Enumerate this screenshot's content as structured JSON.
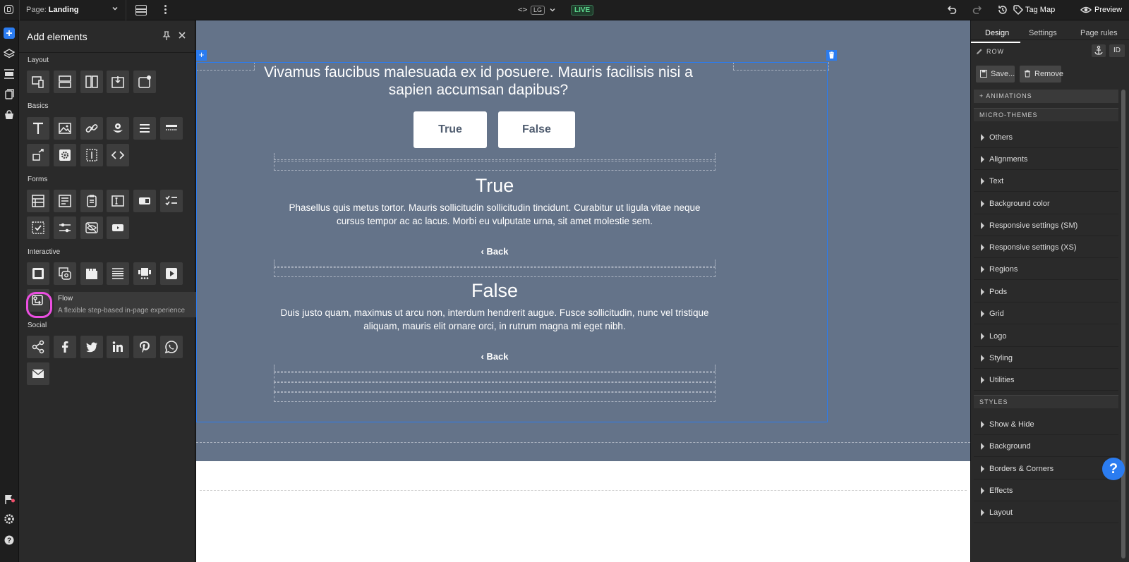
{
  "topbar": {
    "page_label": "Page:",
    "page_value": "Landing",
    "breakpoint_code": "<>",
    "breakpoint": "LG",
    "live": "LIVE",
    "tag_map": "Tag Map",
    "preview": "Preview"
  },
  "panel": {
    "title": "Add elements",
    "sections": {
      "layout": "Layout",
      "basics": "Basics",
      "forms": "Forms",
      "interactive": "Interactive",
      "social": "Social"
    },
    "tooltip": {
      "title": "Flow",
      "desc": "A flexible step-based in-page experience"
    }
  },
  "canvas": {
    "question": "Vivamus faucibus malesuada ex id posuere. Mauris facilisis nisi a sapien accumsan dapibus?",
    "true_button": "True",
    "false_button": "False",
    "true_title": "True",
    "true_body": "Phasellus quis metus tortor. Mauris sollicitudin sollicitudin tincidunt. Curabitur ut ligula vitae neque cursus tempor ac ac lacus. Morbi eu vulputate urna, sit amet molestie sem.",
    "false_title": "False",
    "false_body": "Duis justo quam, maximus ut arcu non, interdum hendrerit augue. Fusce sollicitudin, nunc vel tristique aliquam, mauris elit ornare orci, in rutrum magna mi eget nibh.",
    "back": "Back",
    "back2": "Back",
    "plus": "+"
  },
  "right": {
    "tabs": [
      "Design",
      "Settings",
      "Page rules"
    ],
    "row_label": "ROW",
    "id_label": "ID",
    "save": "Save...",
    "remove": "Remove",
    "animations": "+ ANIMATIONS",
    "micro_themes": "MICRO-THEMES",
    "micro_items": [
      "Others",
      "Alignments",
      "Text",
      "Background color",
      "Responsive settings (SM)",
      "Responsive settings (XS)",
      "Regions",
      "Pods",
      "Grid",
      "Logo",
      "Styling",
      "Utilities"
    ],
    "styles": "STYLES",
    "style_items": [
      "Show & Hide",
      "Background",
      "Borders & Corners",
      "Effects",
      "Layout"
    ]
  },
  "help": "?"
}
